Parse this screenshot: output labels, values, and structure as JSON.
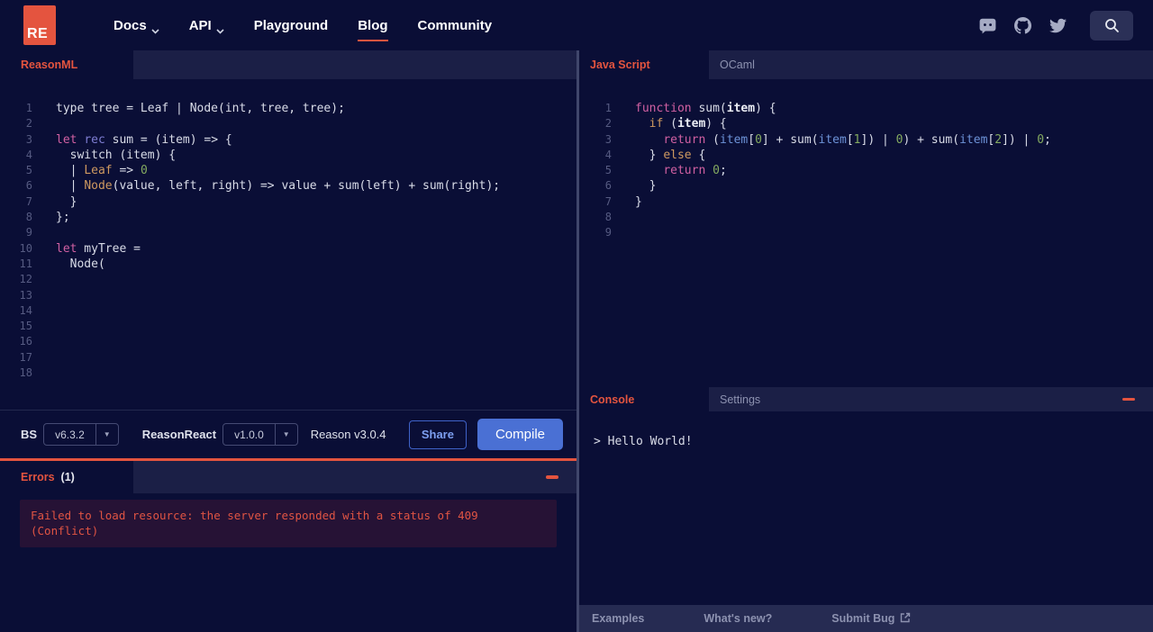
{
  "header": {
    "logo": "RE",
    "nav_items": [
      {
        "label": "Docs",
        "chevron": true,
        "active": false
      },
      {
        "label": "API",
        "chevron": true,
        "active": false
      },
      {
        "label": "Playground",
        "chevron": false,
        "active": false
      },
      {
        "label": "Blog",
        "chevron": false,
        "active": true
      },
      {
        "label": "Community",
        "chevron": false,
        "active": false
      }
    ],
    "social_icons": [
      "discord-icon",
      "github-icon",
      "twitter-icon"
    ],
    "search_icon": "magnifier"
  },
  "left_pane": {
    "tab_label": "ReasonML",
    "code": [
      [
        [
          "type tree = Leaf | Node(int, tree, tree);",
          "plain"
        ]
      ],
      [],
      [
        [
          "let",
          "kw"
        ],
        [
          " ",
          "plain"
        ],
        [
          "rec",
          "kw2"
        ],
        [
          " sum = (item) => {",
          "plain"
        ]
      ],
      [
        [
          "  switch (item) {",
          "plain"
        ]
      ],
      [
        [
          "  | ",
          "plain"
        ],
        [
          "Leaf",
          "ctor"
        ],
        [
          " => ",
          "plain"
        ],
        [
          "0",
          "num"
        ]
      ],
      [
        [
          "  | ",
          "plain"
        ],
        [
          "Node",
          "ctor"
        ],
        [
          "(value, left, right) => value + sum(left) + sum(right);",
          "plain"
        ]
      ],
      [
        [
          "  }",
          "plain"
        ]
      ],
      [
        [
          "};",
          "plain"
        ]
      ],
      [],
      [
        [
          "let",
          "kw"
        ],
        [
          " myTree =",
          "plain"
        ]
      ],
      [
        [
          "  Node(",
          "plain"
        ]
      ],
      [],
      [],
      [],
      [],
      [],
      [],
      []
    ],
    "toolbar": {
      "bs_label": "BS",
      "bs_version": "v6.3.2",
      "reasonreact_label": "ReasonReact",
      "reasonreact_version": "v1.0.0",
      "reason_version": "Reason v3.0.4",
      "share_label": "Share",
      "compile_label": "Compile"
    },
    "errors": {
      "title": "Errors",
      "count": "(1)",
      "message_lines": [
        "Failed to load resource: the server responded with a status of 409",
        "(Conflict)"
      ]
    }
  },
  "right_pane": {
    "tabs": [
      {
        "label": "Java Script",
        "active": true
      },
      {
        "label": "OCaml",
        "active": false
      }
    ],
    "code": [
      [
        [
          "function",
          "kw"
        ],
        [
          " sum(",
          "plain"
        ],
        [
          "item",
          "bold"
        ],
        [
          ") {",
          "plain"
        ]
      ],
      [
        [
          "  ",
          "plain"
        ],
        [
          "if",
          "ctor"
        ],
        [
          " (",
          "plain"
        ],
        [
          "item",
          "bold"
        ],
        [
          ") {",
          "plain"
        ]
      ],
      [
        [
          "    ",
          "plain"
        ],
        [
          "return",
          "kw"
        ],
        [
          " (",
          "plain"
        ],
        [
          "item",
          "var"
        ],
        [
          "[",
          "plain"
        ],
        [
          "0",
          "num"
        ],
        [
          "] + sum(",
          "plain"
        ],
        [
          "item",
          "var"
        ],
        [
          "[",
          "plain"
        ],
        [
          "1",
          "num"
        ],
        [
          "]) | ",
          "plain"
        ],
        [
          "0",
          "num"
        ],
        [
          ") + sum(",
          "plain"
        ],
        [
          "item",
          "var"
        ],
        [
          "[",
          "plain"
        ],
        [
          "2",
          "num"
        ],
        [
          "]) | ",
          "plain"
        ],
        [
          "0",
          "num"
        ],
        [
          ";",
          "plain"
        ]
      ],
      [
        [
          "  } ",
          "plain"
        ],
        [
          "else",
          "ctor"
        ],
        [
          " {",
          "plain"
        ]
      ],
      [
        [
          "    ",
          "plain"
        ],
        [
          "return",
          "kw"
        ],
        [
          " ",
          "plain"
        ],
        [
          "0",
          "num"
        ],
        [
          ";",
          "plain"
        ]
      ],
      [
        [
          "  }",
          "plain"
        ]
      ],
      [
        [
          "}",
          "plain"
        ]
      ],
      [],
      []
    ],
    "console": {
      "tabs": [
        {
          "label": "Console",
          "active": true
        },
        {
          "label": "Settings",
          "active": false
        }
      ],
      "output": "> Hello World!"
    },
    "footer_links": [
      "Examples",
      "What's new?",
      "Submit Bug"
    ]
  },
  "colors": {
    "accent_red": "#e4543f",
    "accent_blue": "#4a70d4",
    "background": "#0a0e36"
  }
}
